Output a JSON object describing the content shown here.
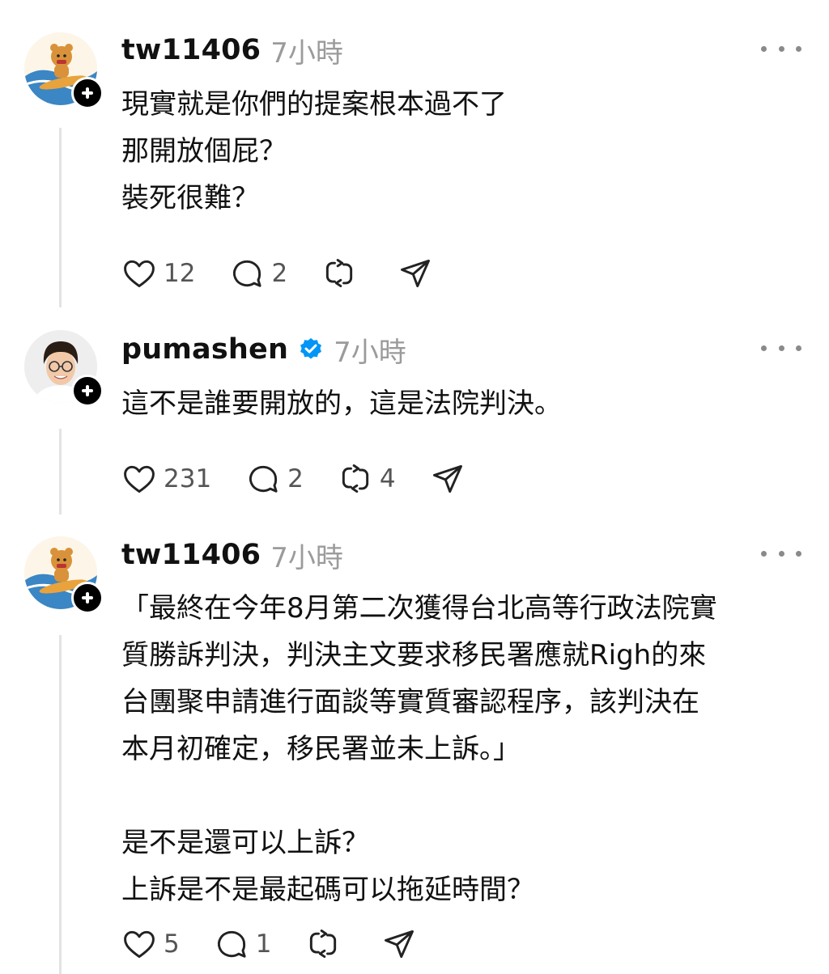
{
  "posts": [
    {
      "username": "tw11406",
      "time": "7小時",
      "avatar": "bear-surfing-avatar",
      "lines": [
        "現實就是你們的提案根本過不了",
        "那開放個屁？",
        "裝死很難？"
      ],
      "likes": "12",
      "replies": "2",
      "reposts": "",
      "verified": false
    },
    {
      "username": "pumashen",
      "time": "7小時",
      "avatar": "man-glasses-avatar",
      "lines": [
        "這不是誰要開放的，這是法院判決。"
      ],
      "likes": "231",
      "replies": "2",
      "reposts": "4",
      "verified": true
    },
    {
      "username": "tw11406",
      "time": "7小時",
      "avatar": "bear-surfing-avatar",
      "lines": [
        "「最終在今年8月第二次獲得台北高等行政法院實",
        "質勝訴判決，判決主文要求移民署應就Righ的來",
        "台團聚申請進行面談等實質審認程序，該判決在",
        "本月初確定，移民署並未上訴。」",
        "",
        "是不是還可以上訴？",
        "上訴是不是最起碼可以拖延時間？"
      ],
      "likes": "5",
      "replies": "1",
      "reposts": "",
      "verified": false
    }
  ],
  "colors": {
    "verified_blue": "#0095f6",
    "thread_line": "#e3e3e3",
    "muted_text": "#9b9b9b"
  },
  "icons": [
    "heart-icon",
    "comment-icon",
    "repost-icon",
    "share-icon",
    "more-icon",
    "follow-plus-icon",
    "verified-badge-icon"
  ]
}
